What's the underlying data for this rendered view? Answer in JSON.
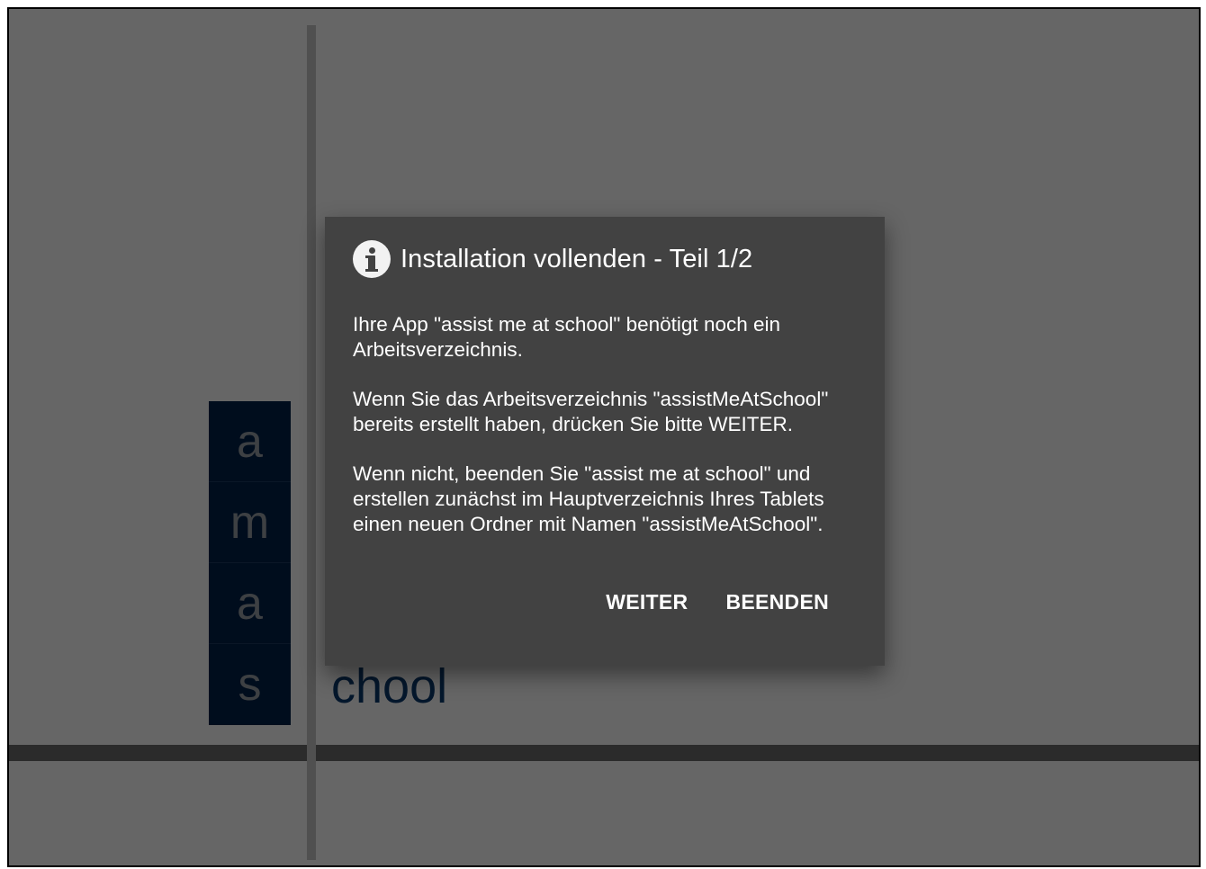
{
  "background": {
    "letters": [
      "a",
      "m",
      "a",
      "s"
    ],
    "word_fragment": "chool",
    "tile_color": "#00224a",
    "word_color": "#0c3a6e"
  },
  "dialog": {
    "icon": "info-icon",
    "title": "Installation vollenden - Teil 1/2",
    "paragraphs": [
      "Ihre App \"assist me at school\" benötigt noch ein\nArbeitsverzeichnis.",
      "Wenn Sie das Arbeitsverzeichnis \"assistMeAtSchool\"\nbereits erstellt haben, drücken Sie bitte WEITER.",
      "Wenn nicht, beenden Sie \"assist me at school\" und\nerstellen zunächst im Hauptverzeichnis Ihres Tablets\neinen neuen Ordner mit Namen \"assistMeAtSchool\"."
    ],
    "buttons": {
      "next_label": "WEITER",
      "quit_label": "BEENDEN"
    },
    "background_color": "#424242"
  }
}
